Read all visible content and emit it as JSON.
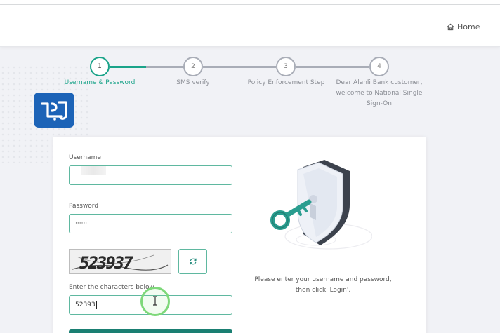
{
  "header": {
    "home_label": "Home"
  },
  "steps": [
    {
      "number": "1",
      "label": "Username & Password"
    },
    {
      "number": "2",
      "label": "SMS verify"
    },
    {
      "number": "3",
      "label": "Policy Enforcement Step"
    },
    {
      "number": "4",
      "label": "Dear Alahli Bank customer, welcome to National Single Sign-On"
    }
  ],
  "form": {
    "username_label": "Username",
    "password_label": "Password",
    "password_value": "·······",
    "captcha_text": "523937",
    "captcha_label": "Enter the characters below",
    "captcha_value": "52393"
  },
  "side": {
    "hint_line1": "Please enter your username and password,",
    "hint_line2": "then click 'Login'."
  },
  "colors": {
    "accent": "#1aa389",
    "inactive": "#a9adb7",
    "logo_blue": "#1c63b7"
  }
}
